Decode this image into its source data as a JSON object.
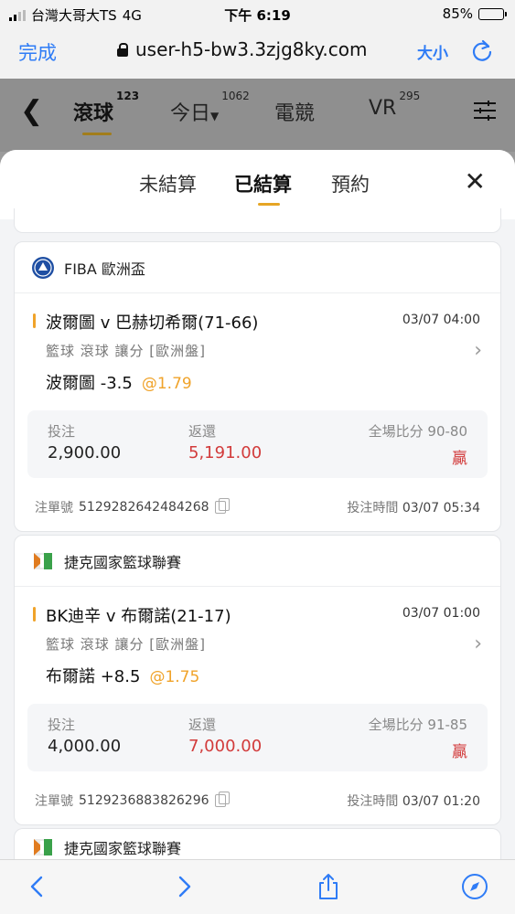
{
  "status": {
    "carrier": "台灣大哥大TS",
    "network": "4G",
    "time": "下午 6:19",
    "battery": "85%",
    "battery_level": 0.85
  },
  "browser": {
    "done_label": "完成",
    "url": "user-h5-bw3.3zjg8ky.com",
    "text_size_label": "大小"
  },
  "app_nav": {
    "tabs": [
      {
        "label": "滾球",
        "count": "123"
      },
      {
        "label": "今日",
        "count": "1062"
      },
      {
        "label": "電競",
        "count": ""
      },
      {
        "label": "VR",
        "count": "295"
      }
    ]
  },
  "sheet": {
    "tabs": [
      "未結算",
      "已結算",
      "預約"
    ],
    "active_tab": "已結算"
  },
  "labels": {
    "stake": "投注",
    "return": "返還",
    "full_score": "全場比分",
    "order_no": "注單號",
    "placed_time": "投注時間"
  },
  "bets": [
    {
      "league": "FIBA 歐洲盃",
      "match": "波爾圖 v 巴赫切希爾(71-66)",
      "time": "03/07 04:00",
      "bet_type": "籃球  滾球  讓分  [歐洲盤]",
      "pick": "波爾圖 -3.5",
      "odds": "@1.79",
      "stake": "2,900.00",
      "return": "5,191.00",
      "score": "90-80",
      "result": "贏",
      "order_no": "5129282642484268",
      "placed_time": "03/07 05:34"
    },
    {
      "league": "捷克國家籃球聯賽",
      "match": "BK迪辛 v 布爾諾(21-17)",
      "time": "03/07 01:00",
      "bet_type": "籃球  滾球  讓分  [歐洲盤]",
      "pick": "布爾諾 +8.5",
      "odds": "@1.75",
      "stake": "4,000.00",
      "return": "7,000.00",
      "score": "91-85",
      "result": "贏",
      "order_no": "5129236883826296",
      "placed_time": "03/07 01:20"
    }
  ],
  "next_card": {
    "league": "捷克國家籃球聯賽"
  },
  "colors": {
    "accent_blue": "#2f7cf6",
    "gold": "#f0a32a",
    "win_red": "#d23b3b"
  }
}
